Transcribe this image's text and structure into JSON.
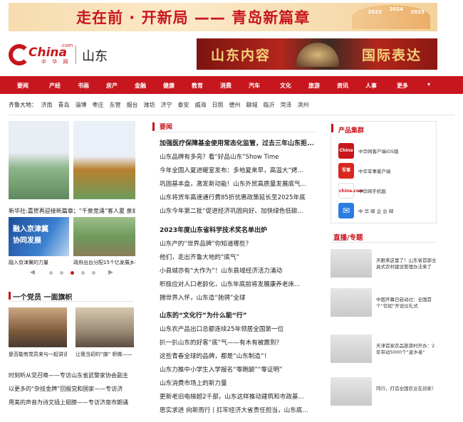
{
  "top_banner": {
    "title": "走在前 · 开新局 —— 青岛新篇章",
    "years": [
      "2023",
      "2024",
      "2025"
    ]
  },
  "logo": {
    "brand": "China",
    "dotcom": ".com",
    "cn": "中 华 网",
    "region": "山东"
  },
  "ad_banner": {
    "left": "山东内容",
    "right": "国际表达"
  },
  "nav": [
    "要闻",
    "产经",
    "书画",
    "房产",
    "金融",
    "健康",
    "教育",
    "消费",
    "汽车",
    "文化",
    "旅游",
    "资讯",
    "人事",
    "更多"
  ],
  "cities": {
    "label": "齐鲁大地：",
    "items": [
      "济南",
      "青岛",
      "淄博",
      "枣庄",
      "东营",
      "烟台",
      "潍坊",
      "济宁",
      "泰安",
      "威海",
      "日照",
      "德州",
      "聊城",
      "临沂",
      "菏泽",
      "滨州"
    ]
  },
  "carousel": {
    "caption": "新华社:嘉贺再迎接新篇章；“千泉竞涌”客人夏 泉城",
    "captions2": [
      "融入京津冀的力量",
      "政府出台分配15个亿发展乡村"
    ],
    "promo": [
      "融入京津冀",
      "协同发展"
    ]
  },
  "party": {
    "title": "一个党员 一面旗帜",
    "caption": [
      "是否能有党员来与一起讲话",
      "让我当初的“旗” 帜做——"
    ],
    "lines": [
      "时刻听从党召唤——专访山东省武警家协会副主",
      "以更多的“杂技金牌”回报党和国家——专访济",
      "用美的声音为诗文插上翅膀——专访济南市朗诵"
    ]
  },
  "center": {
    "heading": "要闻",
    "group1": [
      "加强医疗保障基金使用常态化监管，过去三年山东拒...",
      "山东品牌有多亮？看“好品山东”Show Time",
      "今年全国人夏进暖室发布：多地夏来早，高温大“烤...",
      "巩固基本盘，激发新动能！山东外贸高质量发展底气...",
      "山东将货车高速通行费85折优惠政策延长至2025年底",
      "山东今年第二批“促进经济巩固向好、加快绿色低碳..."
    ],
    "group2": [
      "2023年度山东省科学技术奖名单出炉",
      "山东产的“世界品牌”你知道哪些？",
      "他们，走出齐鲁大地的“底气”",
      "小县城亦有“大作为”！山东县域经济活力涌动",
      "积极应对人口老龄化，山东年底前将发展康养老床...",
      "拥世界入怀，山东造“驰骋”全球"
    ],
    "group3": [
      "山东的“文化行”为什么能“行”",
      "山东农产品出口总额连续25年领居全国第一位",
      "扒一扒山东的好客“底”气——有木有被震到？",
      "这些青春全球的品牌，都是“山东制造”！",
      "山东力推中小学生入学报名“零跑腿”“零证明”",
      "山东消费市场上的新力量",
      "更新老旧电梯超2千部，山东这样推动建筑和市政基...",
      "思实求进 向新而行丨扛牢经济大省责任担当，山东底..."
    ]
  },
  "products": {
    "title": "产品集群",
    "items": [
      {
        "icon": "China",
        "label": "中华网客户端iOS版",
        "color": "#c8161e"
      },
      {
        "icon": "军事",
        "label": "中华军事客户端",
        "color": "#d8281f"
      },
      {
        "icon": "china.com",
        "label": "中华网手机版",
        "color": "#ffffff"
      },
      {
        "icon": "mail",
        "label": "中 华 邮  企 业 邮",
        "color": "#2a7de1"
      }
    ]
  },
  "live": {
    "title": "直播/专题",
    "items": [
      "天眼来这里了！山东省首部全具式农村建设管理办法来了",
      "中国开幕日启动过：全国首个“信如”开设仪礼式",
      "天津首家农品旅游村开办：2年带动5000个“返乡者”",
      "同行，打造全国农业在创家！"
    ]
  }
}
